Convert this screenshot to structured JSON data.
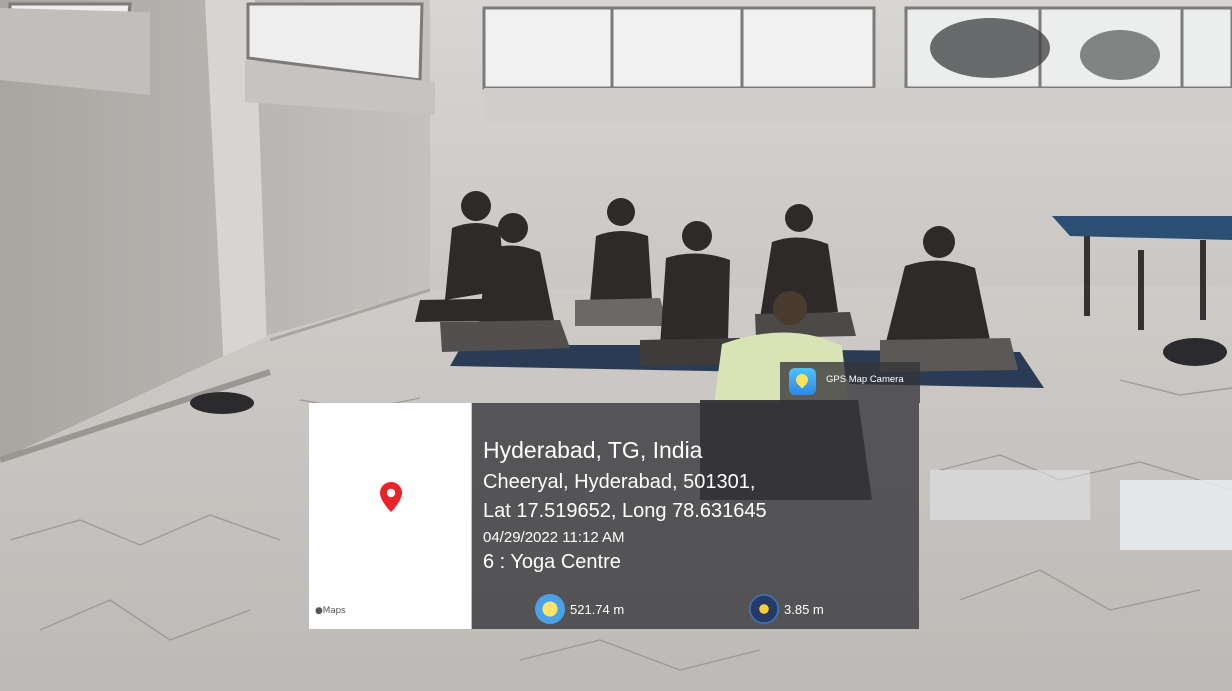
{
  "overlay": {
    "app_name": "GPS Map Camera",
    "app_icon": "gps-map-camera-icon",
    "location_title": "Hyderabad, TG, India",
    "address": "Cheeryal, Hyderabad, 501301,",
    "coordinates": "Lat 17.519652, Long 78.631645",
    "datetime": "04/29/2022 11:12 AM",
    "note": "6 : Yoga Centre",
    "altitude": "521.74 m",
    "accuracy": "3.85 m",
    "map_credit": "Maps",
    "pin_color": "#e8232a"
  },
  "scene": {
    "description_icon": "yoga-room-photo"
  }
}
